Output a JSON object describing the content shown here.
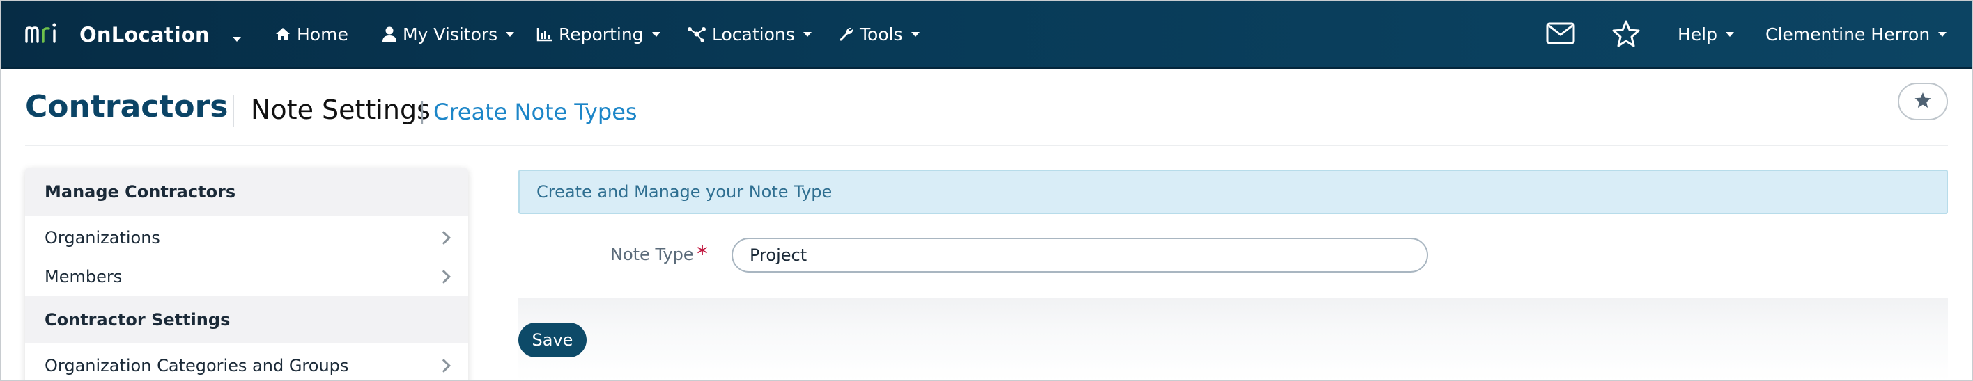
{
  "app": {
    "name": "OnLocation",
    "logo_text": "mri"
  },
  "nav": {
    "home": "Home",
    "my_visitors": "My Visitors",
    "reporting": "Reporting",
    "locations": "Locations",
    "tools": "Tools",
    "help": "Help",
    "user": "Clementine Herron"
  },
  "icons": {
    "home": "home-icon",
    "visitors": "user-icon",
    "reporting": "bar-chart-icon",
    "locations": "network-icon",
    "tools": "wrench-icon",
    "mail": "envelope-icon",
    "favorites": "star-icon"
  },
  "header": {
    "title": "Contractors",
    "subtitle": "Note Settings",
    "separator": "|",
    "link": "Create Note Types"
  },
  "sidebar": {
    "sections": [
      {
        "title": "Manage Contractors",
        "items": [
          {
            "label": "Organizations"
          },
          {
            "label": "Members"
          }
        ]
      },
      {
        "title": "Contractor Settings",
        "items": [
          {
            "label": "Organization Categories and Groups"
          }
        ]
      }
    ]
  },
  "main": {
    "banner": "Create and Manage your Note Type",
    "note_type_label": "Note Type",
    "required_marker": "*",
    "note_type_value": "Project",
    "save_label": "Save"
  },
  "colors": {
    "nav_background": "#083a57",
    "title": "#0b4466",
    "link": "#1d86c8",
    "banner_background": "#d9edf7",
    "required": "#c0133b",
    "save_button": "#0d4a68"
  }
}
